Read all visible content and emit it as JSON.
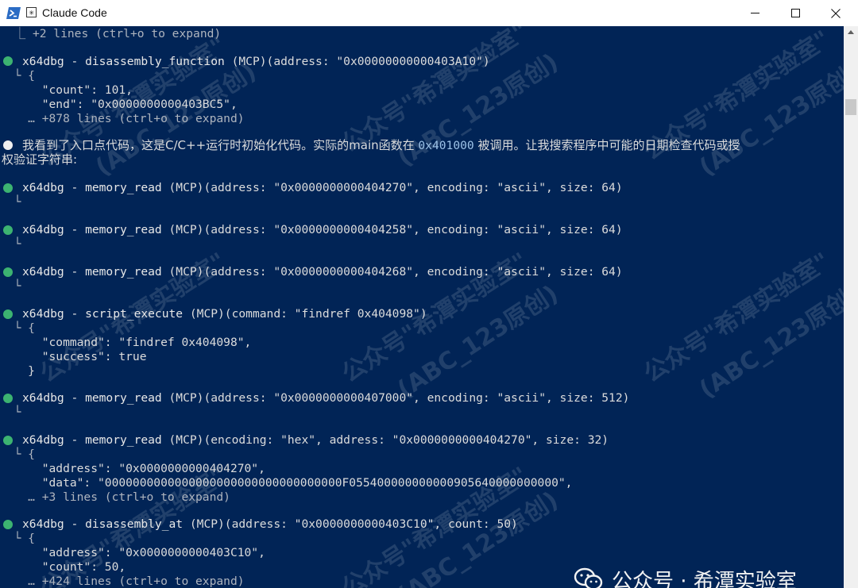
{
  "window": {
    "title": "Claude Code",
    "controls": [
      "minimize",
      "maximize",
      "close"
    ]
  },
  "colors": {
    "terminal_bg": "#012456",
    "bullet_green": "#3cb371",
    "text": "#dcdcdc"
  },
  "terminal": {
    "line_0": "  ⎿ +2 lines (ctrl+o to expand)",
    "call_1": {
      "tool": "x64dbg - disassembly_function",
      "args": " (MCP)(address: \"0x00000000000403A10\")"
    },
    "out_1": [
      "  └ {",
      "      \"count\": 101,",
      "      \"end\": \"0x0000000000403BC5\",",
      "    … +878 lines (ctrl+o to expand)"
    ],
    "msg_1": {
      "part1": "我看到了入口点代码，这是C/C++运行时初始化代码。实际的main函数在 ",
      "addr": "0x401000",
      "part2": " 被调用。让我搜索程序中可能的日期检查代码或授",
      "line2": "权验证字符串:"
    },
    "call_2": {
      "tool": "x64dbg - memory_read",
      "args": " (MCP)(address: \"0x0000000000404270\", encoding: \"ascii\", size: 64)"
    },
    "call_3": {
      "tool": "x64dbg - memory_read",
      "args": " (MCP)(address: \"0x0000000000404258\", encoding: \"ascii\", size: 64)"
    },
    "call_4": {
      "tool": "x64dbg - memory_read",
      "args": " (MCP)(address: \"0x0000000000404268\", encoding: \"ascii\", size: 64)"
    },
    "call_5": {
      "tool": "x64dbg - script_execute",
      "args": " (MCP)(command: \"findref 0x404098\")"
    },
    "out_5": [
      "  └ {",
      "      \"command\": \"findref 0x404098\",",
      "      \"success\": true",
      "    }"
    ],
    "call_6": {
      "tool": "x64dbg - memory_read",
      "args": " (MCP)(address: \"0x0000000000407000\", encoding: \"ascii\", size: 512)"
    },
    "call_7": {
      "tool": "x64dbg - memory_read",
      "args": " (MCP)(encoding: \"hex\", address: \"0x0000000000404270\", size: 32)"
    },
    "out_7": [
      "  └ {",
      "      \"address\": \"0x0000000000404270\",",
      "      \"data\": \"0000000000000000000000000000000000F055400000000000905640000000000\",",
      "    … +3 lines (ctrl+o to expand)"
    ],
    "call_8": {
      "tool": "x64dbg - disassembly_at",
      "args": " (MCP)(address: \"0x0000000000403C10\", count: 50)"
    },
    "out_8": [
      "  └ {",
      "      \"address\": \"0x0000000000403C10\",",
      "      \"count\": 50,",
      "    … +424 lines (ctrl+o to expand)"
    ],
    "empty_result": "  └"
  },
  "watermark": {
    "line1": "公众号\"希潭实验室\"",
    "line2": "(ABC_123原创)",
    "brand": "公众号 · 希潭实验室",
    "brand_icon": "wechat-icon"
  }
}
